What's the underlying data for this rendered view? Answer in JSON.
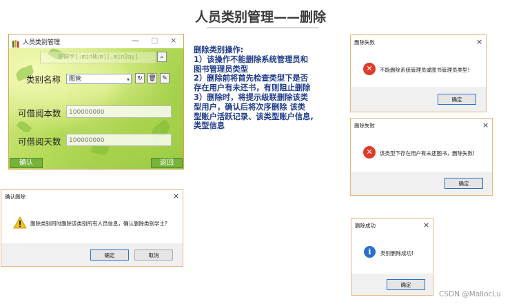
{
  "page": {
    "title": "人员类别管理——删除",
    "watermark": "CSDN @MallocLu"
  },
  "app_window": {
    "title": "人员类别管理",
    "minimize": "—",
    "maximize": "□",
    "close": "×",
    "keyword_placeholder": "关键字[:minNum][,minDay]",
    "category_label": "类别名称",
    "category_value": "图管",
    "max_books_label": "可借阅本数",
    "max_books_value": "100000000",
    "max_days_label": "可借阅天数",
    "max_days_value": "100000000",
    "confirm_label": "确认",
    "back_label": "返回"
  },
  "description": {
    "lines": [
      "删除类别操作:",
      "1）该操作不能删除系统管理员和",
      "图书管理员类型",
      "2）删除前将首先检查类型下是否",
      "存在用户有未还书，有则阻止删除",
      "3）删除时，将提示级联删除该类",
      "型用户，确认后将次序删除 该类",
      "型账户活跃记录、该类型账户信息,",
      "类型信息"
    ]
  },
  "dialogs": {
    "fail1": {
      "title": "删除失败",
      "message": "不能删除系统管理员或图书管理员类型!",
      "ok": "确定",
      "close": "×"
    },
    "fail2": {
      "title": "删除失败",
      "message": "该类型下存在用户有未还图书，删除失败!",
      "ok": "确定",
      "close": "×"
    },
    "confirm": {
      "title": "确认删除",
      "message": "删除类别同时删除该类别所有人员信息，确认删除类别学士?",
      "ok": "确定",
      "cancel": "取消",
      "close": "×"
    },
    "success": {
      "title": "删除成功",
      "message": "类别删除成功!",
      "ok": "确定",
      "close": "×"
    }
  },
  "colors": {
    "accent_blue": "#1f3c8c",
    "error_red": "#e03a2a",
    "info_blue": "#2a6fc9",
    "dialog_border": "#e6b37a"
  }
}
